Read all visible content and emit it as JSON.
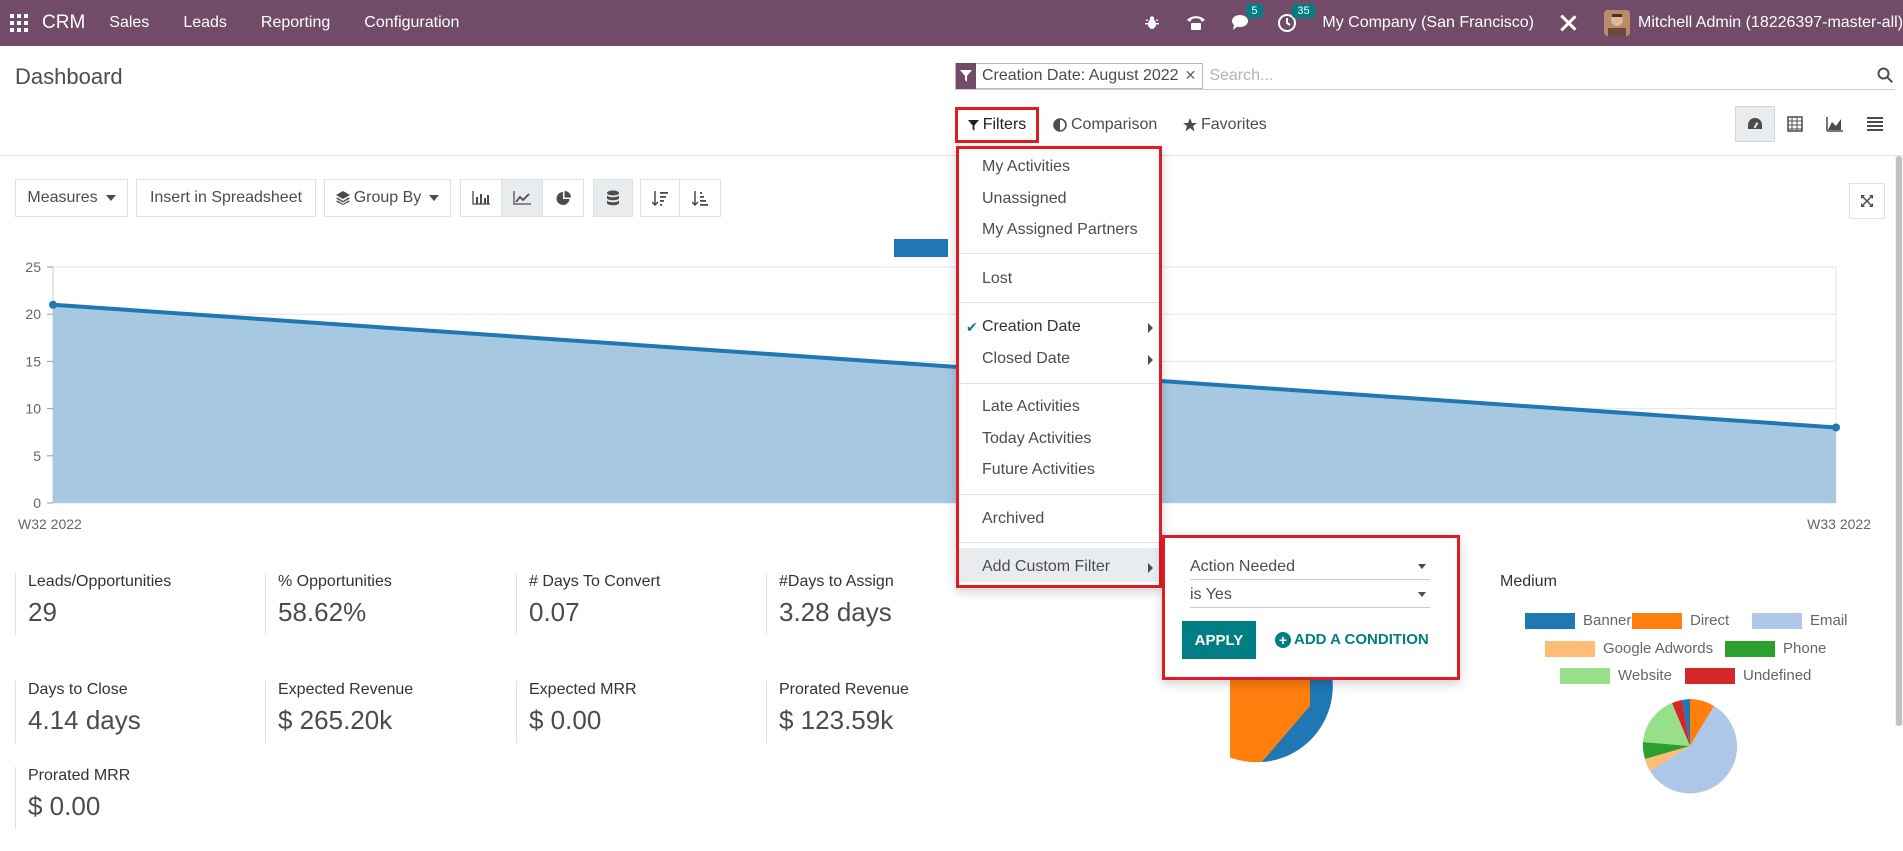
{
  "navbar": {
    "brand": "CRM",
    "menu": [
      "Sales",
      "Leads",
      "Reporting",
      "Configuration"
    ],
    "messages_count": "5",
    "activities_count": "35",
    "company": "My Company (San Francisco)",
    "user": "Mitchell Admin (18226397-master-all)"
  },
  "page": {
    "title": "Dashboard"
  },
  "search": {
    "facet": "Creation Date: August 2022",
    "placeholder": "Search..."
  },
  "controls": {
    "filters": "Filters",
    "comparison": "Comparison",
    "favorites": "Favorites"
  },
  "toolbar": {
    "measures": "Measures",
    "insert_spreadsheet": "Insert in Spreadsheet",
    "group_by": "Group By"
  },
  "chart_data": {
    "type": "area",
    "x": [
      "W32 2022",
      "W33 2022"
    ],
    "series": [
      {
        "values": [
          21,
          8
        ]
      }
    ],
    "ylim": [
      0,
      25
    ],
    "yticks": [
      "0",
      "5",
      "10",
      "15",
      "20",
      "25"
    ],
    "grid": true,
    "color": "#1f77b4"
  },
  "kpis": [
    {
      "label": "Leads/Opportunities",
      "value": "29"
    },
    {
      "label": "% Opportunities",
      "value": "58.62%"
    },
    {
      "label": "# Days To Convert",
      "value": "0.07"
    },
    {
      "label": "#Days to Assign",
      "value": "3.28 days"
    },
    {
      "label": "Days to Close",
      "value": "4.14 days"
    },
    {
      "label": "Expected Revenue",
      "value": "$ 265.20k"
    },
    {
      "label": "Expected MRR",
      "value": "$ 0.00"
    },
    {
      "label": "Prorated Revenue",
      "value": "$ 123.59k"
    },
    {
      "label": "Prorated MRR",
      "value": "$ 0.00"
    }
  ],
  "medium": {
    "title": "Medium",
    "legend": [
      {
        "label": "Banner",
        "color": "#1f77b4"
      },
      {
        "label": "Direct",
        "color": "#ff7f0e"
      },
      {
        "label": "Email",
        "color": "#aec7e8"
      },
      {
        "label": "Google Adwords",
        "color": "#ffbb78"
      },
      {
        "label": "Phone",
        "color": "#2ca02c"
      },
      {
        "label": "Website",
        "color": "#98df8a"
      },
      {
        "label": "Undefined",
        "color": "#d62728"
      }
    ]
  },
  "filters_menu": {
    "items": [
      "My Activities",
      "Unassigned",
      "My Assigned Partners",
      "Lost",
      "Creation Date",
      "Closed Date",
      "Late Activities",
      "Today Activities",
      "Future Activities",
      "Archived",
      "Add Custom Filter"
    ]
  },
  "custom_filter": {
    "field": "Action Needed",
    "operator": "is Yes",
    "apply": "APPLY",
    "add_condition": "ADD A CONDITION"
  }
}
